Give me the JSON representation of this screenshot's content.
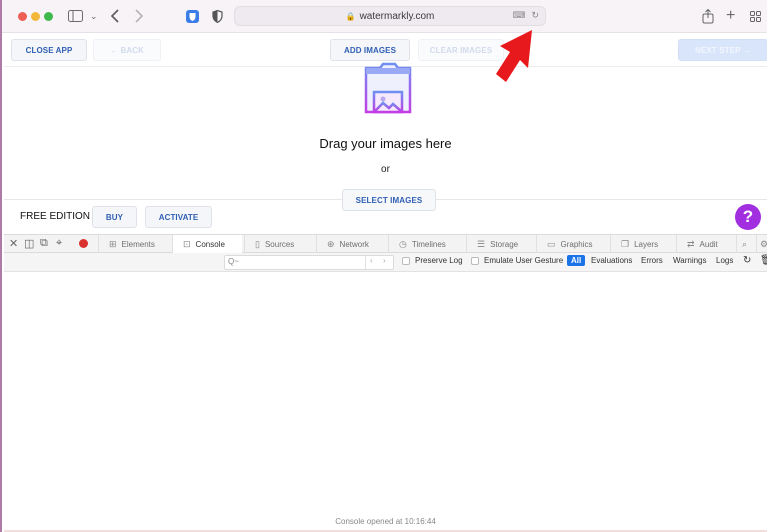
{
  "browser": {
    "url": "watermarkly.com",
    "icons": {
      "sidebar": "sidebar-icon",
      "back": "chevron-left-icon",
      "forward": "chevron-right-icon",
      "password": "bitwarden-shield-icon",
      "privacy": "privacy-shield-icon",
      "translate": "translate-icon",
      "reload": "reload-icon",
      "share": "share-icon",
      "new_tab": "plus-icon",
      "tab_overview": "grid-icon"
    }
  },
  "app": {
    "header": {
      "close_app": "CLOSE APP",
      "back": "← BACK",
      "add_images": "ADD IMAGES",
      "clear_images": "CLEAR IMAGES",
      "next_step": "NEXT STEP →"
    },
    "dropzone": {
      "title": "Drag your images here",
      "or": "or",
      "select_images": "SELECT IMAGES"
    },
    "footer": {
      "edition": "FREE EDITION",
      "buy": "BUY",
      "activate": "ACTIVATE",
      "help": "?"
    },
    "colors": {
      "accent_blue": "#2f5fb3",
      "help_purple": "#a12fe0",
      "pointer_red": "#e8191c"
    }
  },
  "devtools": {
    "tabs": [
      {
        "label": "Elements",
        "icon": "elements-icon"
      },
      {
        "label": "Console",
        "icon": "console-icon",
        "active": true
      },
      {
        "label": "Sources",
        "icon": "sources-icon"
      },
      {
        "label": "Network",
        "icon": "network-icon"
      },
      {
        "label": "Timelines",
        "icon": "timelines-icon"
      },
      {
        "label": "Storage",
        "icon": "storage-icon"
      },
      {
        "label": "Graphics",
        "icon": "graphics-icon"
      },
      {
        "label": "Layers",
        "icon": "layers-icon"
      },
      {
        "label": "Audit",
        "icon": "audit-icon"
      }
    ],
    "filter": {
      "search_placeholder": "Q~",
      "preserve_log": "Preserve Log",
      "emulate_gesture": "Emulate User Gesture",
      "levels": [
        "All",
        "Evaluations",
        "Errors",
        "Warnings",
        "Logs"
      ]
    },
    "console_message": "Console opened at 10:16:44"
  }
}
